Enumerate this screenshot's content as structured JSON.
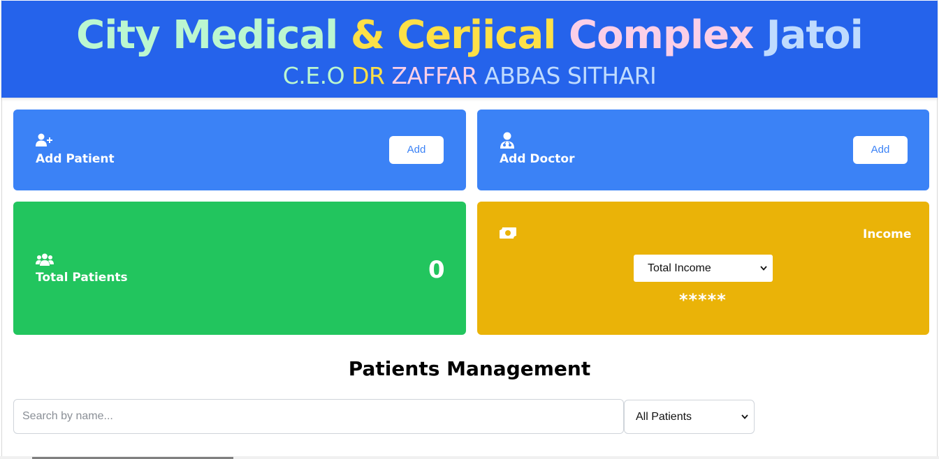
{
  "header": {
    "title_parts": [
      {
        "text": "City Medical ",
        "color": "#bbf7d0"
      },
      {
        "text": "& Cerjical ",
        "color": "#fde047"
      },
      {
        "text": "Complex ",
        "color": "#fbcfe8"
      },
      {
        "text": "Jatoi",
        "color": "#bfdbfe"
      }
    ],
    "subtitle_parts": [
      {
        "text": "C.E.O ",
        "color": "#bbf7d0"
      },
      {
        "text": "DR ",
        "color": "#fde047"
      },
      {
        "text": "ZAFFAR ",
        "color": "#fbcfe8"
      },
      {
        "text": "ABBAS SITHARI",
        "color": "#bfdbfe"
      }
    ],
    "background": "#2563eb"
  },
  "cards": {
    "add_patient": {
      "label": "Add Patient",
      "button": "Add",
      "icon": "user-plus-icon",
      "color": "#3b82f6"
    },
    "add_doctor": {
      "label": "Add Doctor",
      "button": "Add",
      "icon": "doctor-icon",
      "color": "#3b82f6"
    },
    "total_patients": {
      "label": "Total Patients",
      "value": "0",
      "icon": "users-icon",
      "color": "#22c55e"
    },
    "income": {
      "label": "Income",
      "select_value": "Total Income",
      "masked_value": "*****",
      "icon": "money-bill-icon",
      "color": "#eab308"
    }
  },
  "patients": {
    "title": "Patients Management",
    "search_placeholder": "Search by name...",
    "filter_value": "All Patients"
  }
}
